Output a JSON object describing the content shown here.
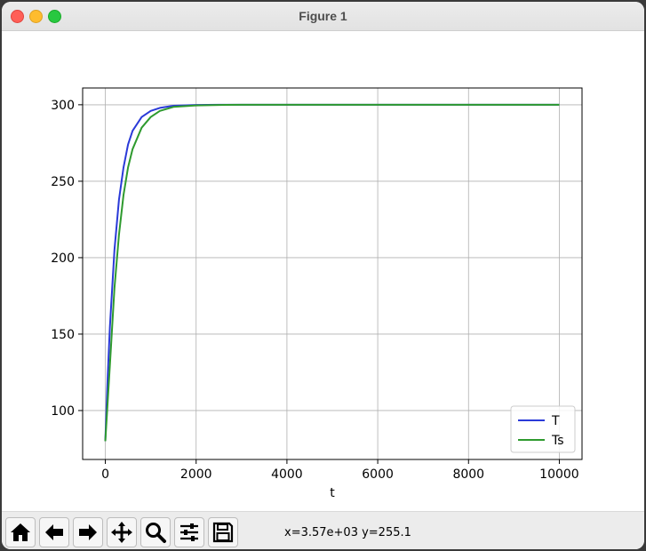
{
  "window": {
    "title": "Figure 1"
  },
  "toolbar": {
    "buttons": [
      {
        "name": "home-button",
        "icon": "home-icon"
      },
      {
        "name": "back-button",
        "icon": "arrow-left-icon"
      },
      {
        "name": "forward-button",
        "icon": "arrow-right-icon"
      },
      {
        "name": "pan-button",
        "icon": "move-icon"
      },
      {
        "name": "zoom-button",
        "icon": "magnifier-icon"
      },
      {
        "name": "configure-subplots-button",
        "icon": "sliders-icon"
      },
      {
        "name": "save-button",
        "icon": "floppy-disk-icon"
      }
    ],
    "coords": "x=3.57e+03 y=255.1"
  },
  "chart_data": {
    "type": "line",
    "xlabel": "t",
    "ylabel": "",
    "xlim": [
      -500,
      10500
    ],
    "ylim": [
      68,
      311
    ],
    "xticks": [
      0,
      2000,
      4000,
      6000,
      8000,
      10000
    ],
    "yticks": [
      100,
      150,
      200,
      250,
      300
    ],
    "grid": true,
    "legend": "lower-right",
    "series": [
      {
        "name": "T",
        "color": "#2a3ad8",
        "x": [
          0,
          50,
          100,
          200,
          300,
          400,
          500,
          600,
          800,
          1000,
          1200,
          1500,
          2000,
          2500,
          3000,
          5000,
          10000
        ],
        "y": [
          80,
          121,
          155,
          205,
          238,
          259,
          274,
          283,
          292,
          296,
          298,
          299.4,
          299.9,
          300,
          300,
          300,
          300
        ]
      },
      {
        "name": "Ts",
        "color": "#2e9a2e",
        "x": [
          0,
          50,
          100,
          200,
          300,
          400,
          500,
          600,
          800,
          1000,
          1200,
          1500,
          2000,
          2500,
          3000,
          5000,
          10000
        ],
        "y": [
          80,
          105,
          130,
          180,
          215,
          241,
          259,
          271,
          285,
          292,
          296,
          298.6,
          299.6,
          299.9,
          300,
          300,
          300
        ]
      }
    ]
  }
}
